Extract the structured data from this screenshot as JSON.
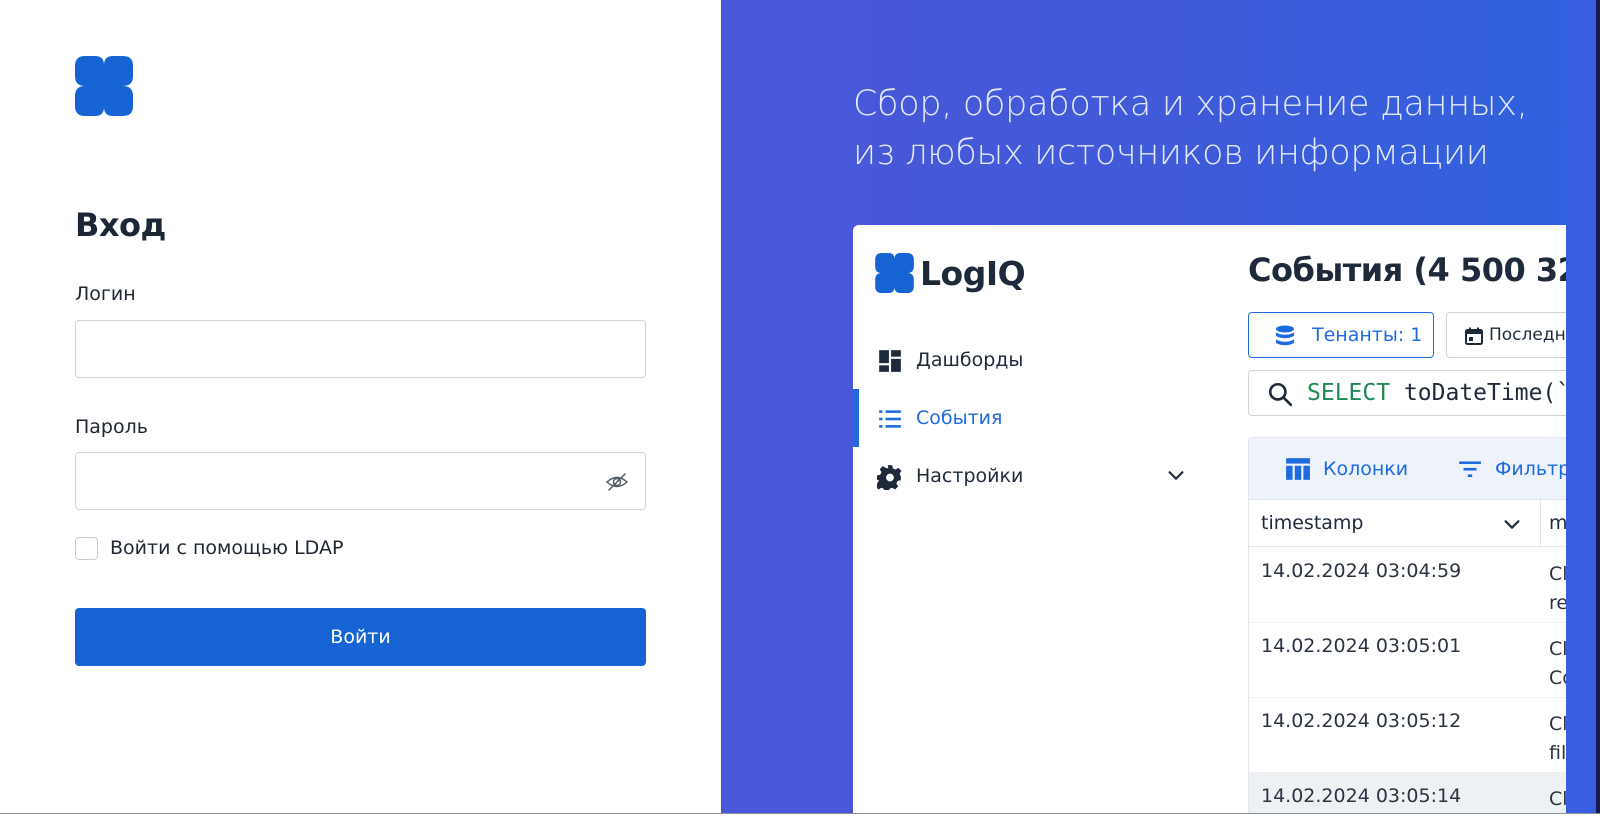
{
  "login": {
    "title": "Вход",
    "login_label": "Логин",
    "login_value": "",
    "password_label": "Пароль",
    "password_value": "",
    "ldap_label": "Войти с помощью LDAP",
    "submit_label": "Войти"
  },
  "promo": {
    "line1": "Сбор, обработка и хранение данных,",
    "line2": "из любых источников информации"
  },
  "app": {
    "logo_text": "LogIQ",
    "nav": [
      {
        "label": "Дашборды",
        "icon": "dashboard-icon"
      },
      {
        "label": "События",
        "icon": "list-icon",
        "active": true
      },
      {
        "label": "Настройки",
        "icon": "gear-icon"
      }
    ],
    "title": "События (4 500 32",
    "tenants_label": "Тенанты: 1",
    "period_label": "Последни",
    "query_keyword": "SELECT",
    "query_rest": " toDateTime(`",
    "toolbar": {
      "columns_label": "Колонки",
      "filter_label": "Фильтр"
    },
    "columns": {
      "timestamp": "timestamp",
      "second": "m"
    },
    "rows": [
      {
        "ts": "14.02.2024 03:04:59",
        "msg": "Cl\nre"
      },
      {
        "ts": "14.02.2024 03:05:01",
        "msg": "Cl\nCo"
      },
      {
        "ts": "14.02.2024 03:05:12",
        "msg": "Cl\nfil"
      },
      {
        "ts": "14.02.2024 03:05:14",
        "msg": "Cl",
        "selected": true
      }
    ]
  },
  "colors": {
    "primary": "#1664d4",
    "accent": "#1e6be0",
    "promo_bg": "#4a57d8"
  }
}
